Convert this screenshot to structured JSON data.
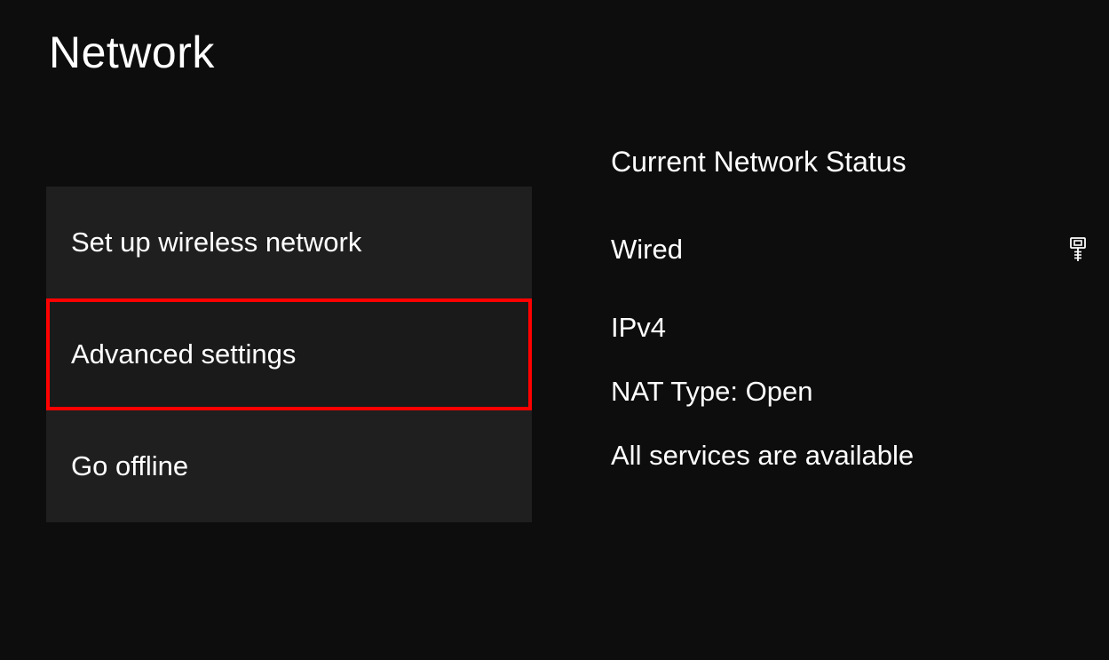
{
  "title": "Network",
  "menu": {
    "items": [
      {
        "label": "Set up wireless network",
        "highlighted": false
      },
      {
        "label": "Advanced settings",
        "highlighted": true
      },
      {
        "label": "Go offline",
        "highlighted": false
      }
    ]
  },
  "status": {
    "heading": "Current Network Status",
    "connection_type": "Wired",
    "ip_version": "IPv4",
    "nat": "NAT Type: Open",
    "services": "All services are available",
    "icon": "ethernet-icon"
  },
  "colors": {
    "highlight_border": "#ff0000",
    "menu_bg": "#1f1f1f",
    "page_bg": "#0d0d0d"
  }
}
